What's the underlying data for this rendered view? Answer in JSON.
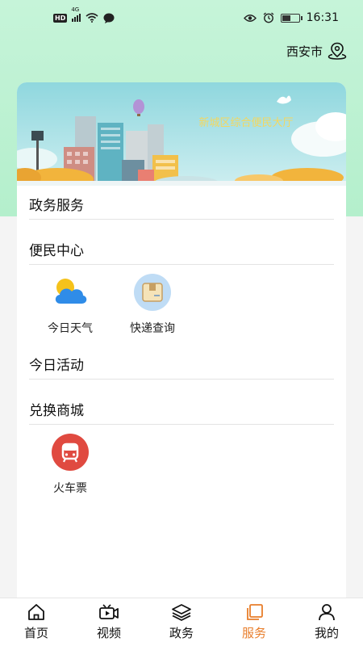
{
  "status_bar": {
    "network": "HD",
    "signal_label": "4G",
    "time": "16:31",
    "icons": [
      "hd-icon",
      "signal-icon",
      "wifi-icon",
      "chat-icon",
      "eye-icon",
      "alarm-icon",
      "battery-icon"
    ],
    "battery_level": 0.45
  },
  "location": {
    "city": "西安市",
    "icon": "location-pin-icon"
  },
  "banner": {
    "title": "新城区综合便民大厅"
  },
  "sections": {
    "government": {
      "title": "政务服务"
    },
    "convenience": {
      "title": "便民中心",
      "items": [
        {
          "label": "今日天气",
          "icon": "weather-icon"
        },
        {
          "label": "快递查询",
          "icon": "package-icon"
        }
      ]
    },
    "activities": {
      "title": "今日活动"
    },
    "mall": {
      "title": "兑换商城",
      "items": [
        {
          "label": "火车票",
          "icon": "train-icon"
        }
      ]
    }
  },
  "tabbar": {
    "active": "服务",
    "tabs": [
      {
        "label": "首页",
        "icon": "home-icon"
      },
      {
        "label": "视频",
        "icon": "video-icon"
      },
      {
        "label": "政务",
        "icon": "layers-icon"
      },
      {
        "label": "服务",
        "icon": "service-icon"
      },
      {
        "label": "我的",
        "icon": "user-icon"
      }
    ]
  },
  "colors": {
    "header_green": "#b4efcc",
    "accent_orange": "#e87d2a",
    "train_red": "#e04a40",
    "weather_blue": "#2f8ce8",
    "weather_sun": "#f5c21b"
  }
}
